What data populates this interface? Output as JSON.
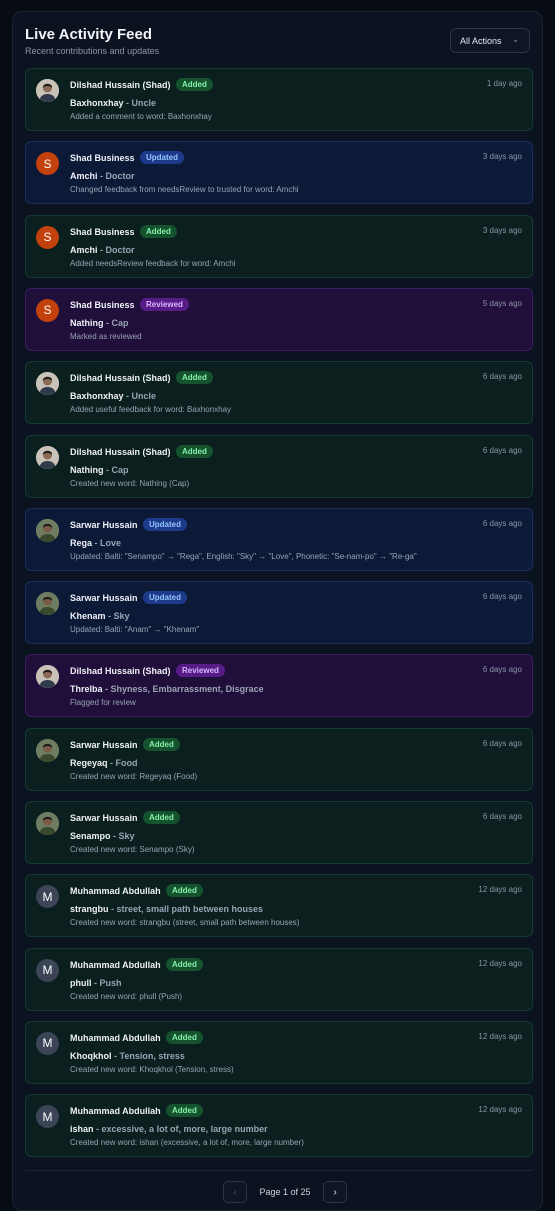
{
  "header": {
    "title": "Live Activity Feed",
    "subtitle": "Recent contributions and updates",
    "filter_label": "All Actions",
    "filter_chevron": "⌄"
  },
  "feed": [
    {
      "user": "Dilshad Hussain (Shad)",
      "action": "Added",
      "type": "added",
      "avatar": "photo-d",
      "avatar_letter": "",
      "time": "1 day ago",
      "word": "Baxhonxhay",
      "meaning": "Uncle",
      "description": "Added a comment to word: Baxhonxhay"
    },
    {
      "user": "Shad Business",
      "action": "Updated",
      "type": "updated",
      "avatar": "letter-s",
      "avatar_letter": "S",
      "time": "3 days ago",
      "word": "Amchi",
      "meaning": "Doctor",
      "description": "Changed feedback from needsReview to trusted for word: Amchi"
    },
    {
      "user": "Shad Business",
      "action": "Added",
      "type": "added",
      "avatar": "letter-s",
      "avatar_letter": "S",
      "time": "3 days ago",
      "word": "Amchi",
      "meaning": "Doctor",
      "description": "Added needsReview feedback for word: Amchi"
    },
    {
      "user": "Shad Business",
      "action": "Reviewed",
      "type": "reviewed",
      "avatar": "letter-s",
      "avatar_letter": "S",
      "time": "5 days ago",
      "word": "Nathing",
      "meaning": "Cap",
      "description": "Marked as reviewed"
    },
    {
      "user": "Dilshad Hussain (Shad)",
      "action": "Added",
      "type": "added",
      "avatar": "photo-d",
      "avatar_letter": "",
      "time": "6 days ago",
      "word": "Baxhonxhay",
      "meaning": "Uncle",
      "description": "Added useful feedback for word: Baxhonxhay"
    },
    {
      "user": "Dilshad Hussain (Shad)",
      "action": "Added",
      "type": "added",
      "avatar": "photo-d",
      "avatar_letter": "",
      "time": "6 days ago",
      "word": "Nathing",
      "meaning": "Cap",
      "description": "Created new word: Nathing (Cap)"
    },
    {
      "user": "Sarwar Hussain",
      "action": "Updated",
      "type": "updated",
      "avatar": "photo-s",
      "avatar_letter": "",
      "time": "6 days ago",
      "word": "Rega",
      "meaning": "Love",
      "description": "Updated: Balti: \"Senampo\" → \"Rega\", English: \"Sky\" → \"Love\", Phonetic: \"Se-nam-po\" → \"Re-ga\""
    },
    {
      "user": "Sarwar Hussain",
      "action": "Updated",
      "type": "updated",
      "avatar": "photo-s",
      "avatar_letter": "",
      "time": "6 days ago",
      "word": "Khenam",
      "meaning": "Sky",
      "description": "Updated: Balti: \"Anam\" → \"Khenam\""
    },
    {
      "user": "Dilshad Hussain (Shad)",
      "action": "Reviewed",
      "type": "reviewed",
      "avatar": "photo-d",
      "avatar_letter": "",
      "time": "6 days ago",
      "word": "Threlba",
      "meaning": "Shyness, Embarrassment, Disgrace",
      "description": "Flagged for review"
    },
    {
      "user": "Sarwar Hussain",
      "action": "Added",
      "type": "added",
      "avatar": "photo-s",
      "avatar_letter": "",
      "time": "6 days ago",
      "word": "Regeyaq",
      "meaning": "Food",
      "description": "Created new word: Regeyaq (Food)"
    },
    {
      "user": "Sarwar Hussain",
      "action": "Added",
      "type": "added",
      "avatar": "photo-s",
      "avatar_letter": "",
      "time": "6 days ago",
      "word": "Senampo",
      "meaning": "Sky",
      "description": "Created new word: Senampo (Sky)"
    },
    {
      "user": "Muhammad Abdullah",
      "action": "Added",
      "type": "added",
      "avatar": "letter-m",
      "avatar_letter": "M",
      "time": "12 days ago",
      "word": "strangbu",
      "meaning": "street, small path between houses",
      "description": "Created new word: strangbu (street, small path between houses)"
    },
    {
      "user": "Muhammad Abdullah",
      "action": "Added",
      "type": "added",
      "avatar": "letter-m",
      "avatar_letter": "M",
      "time": "12 days ago",
      "word": "phull",
      "meaning": "Push",
      "description": "Created new word: phull (Push)"
    },
    {
      "user": "Muhammad Abdullah",
      "action": "Added",
      "type": "added",
      "avatar": "letter-m",
      "avatar_letter": "M",
      "time": "12 days ago",
      "word": "Khoqkhol",
      "meaning": "Tension, stress",
      "description": "Created new word: Khoqkhol (Tension, stress)"
    },
    {
      "user": "Muhammad Abdullah",
      "action": "Added",
      "type": "added",
      "avatar": "letter-m",
      "avatar_letter": "M",
      "time": "12 days ago",
      "word": "ishan",
      "meaning": "excessive, a lot of, more, large number",
      "description": "Created new word: ishan (excessive, a lot of, more, large number)"
    }
  ],
  "pagination": {
    "label": "Page 1 of 25",
    "prev_icon": "‹",
    "next_icon": "›"
  }
}
